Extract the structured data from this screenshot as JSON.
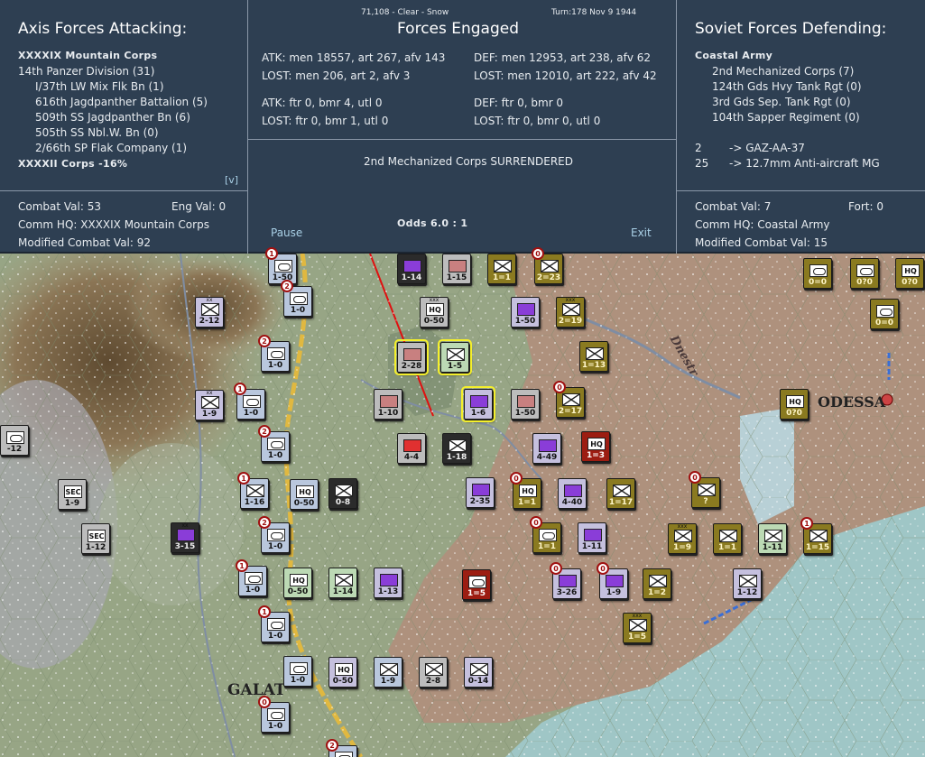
{
  "header": {
    "weather": "71,108 - Clear - Snow",
    "turn": "Turn:178  Nov 9 1944"
  },
  "axis": {
    "title": "Axis Forces Attacking:",
    "corps1": "XXXXIX Mountain Corps",
    "division": "14th Panzer Division (31)",
    "units": [
      "I/37th LW Mix Flk Bn (1)",
      "616th Jagdpanther Battalion (5)",
      "509th SS Jagdpanther Bn (6)",
      "505th SS Nbl.W. Bn (0)",
      "2/66th SP Flak Company (1)"
    ],
    "corps2": "XXXXII Corps  -16%",
    "toggle": "[v]",
    "combat_val": "Combat Val: 53",
    "eng_val": "Eng Val: 0",
    "comm_hq": "Comm HQ: XXXXIX Mountain Corps",
    "modified": "Modified Combat Val: 92"
  },
  "engaged": {
    "title": "Forces Engaged",
    "atk_men": "ATK: men 18557, art 267, afv 143",
    "atk_lost": "LOST: men 206, art 2, afv 3",
    "def_men": "DEF: men 12953, art 238, afv 62",
    "def_lost": "LOST: men 12010, art 222, afv 42",
    "atk_air": "ATK: ftr 0, bmr 4, utl 0",
    "atk_air_lost": "LOST: ftr 0, bmr 1, utl 0",
    "def_air": "DEF: ftr 0, bmr 0",
    "def_air_lost": "LOST: ftr 0, bmr 0, utl 0",
    "result": "2nd Mechanized Corps SURRENDERED",
    "odds": "Odds 6.0 : 1",
    "pause": "Pause",
    "exit": "Exit"
  },
  "soviet": {
    "title": "Soviet Forces Defending:",
    "army": "Coastal Army",
    "units": [
      "2nd Mechanized Corps (7)",
      "124th Gds Hvy Tank Rgt (0)",
      "3rd Gds Sep. Tank Rgt (0)",
      "104th Sapper Regiment (0)"
    ],
    "loss1_n": "2",
    "loss1": "-> GAZ-AA-37",
    "loss2_n": "25",
    "loss2": "-> 12.7mm Anti-aircraft MG",
    "combat_val": "Combat Val: 7",
    "fort": "Fort: 0",
    "comm_hq": "Comm HQ: Coastal Army",
    "modified": "Modified Combat Val: 15"
  },
  "map_labels": {
    "river_dnestr": "Dnestr",
    "city_odessa": "ODESSA",
    "city_galati": "GALAT"
  },
  "counters": [
    {
      "v": "1-50",
      "c": "g-blue",
      "s": "arm",
      "b": "1"
    },
    {
      "v": "1-0",
      "c": "g-blue",
      "s": "arm",
      "b": "2"
    },
    {
      "v": "2-12",
      "c": "g-lav",
      "s": "inf",
      "e": "xx"
    },
    {
      "v": "1-0",
      "c": "g-blue",
      "s": "arm",
      "b": "2"
    },
    {
      "v": "1-9",
      "c": "g-lav",
      "s": "inf",
      "e": "xx"
    },
    {
      "v": "1-0",
      "c": "g-blue",
      "s": "arm",
      "b": "1"
    },
    {
      "v": "1-0",
      "c": "g-blue",
      "s": "arm",
      "b": "2"
    },
    {
      "v": "-12",
      "c": "g-gray",
      "s": "arm"
    },
    {
      "v": "1-9",
      "c": "g-gray",
      "s": "hqsym",
      "t": "SEC"
    },
    {
      "v": "1-12",
      "c": "g-gray",
      "s": "hqsym",
      "t": "SEC"
    },
    {
      "v": "1-16",
      "c": "g-blue",
      "s": "inf",
      "b": "1"
    },
    {
      "v": "0-50",
      "c": "g-blue",
      "s": "hqsym",
      "t": "HQ"
    },
    {
      "v": "0-8",
      "c": "g-black",
      "s": "inf"
    },
    {
      "v": "3-15",
      "c": "g-black",
      "s": "purplesym",
      "e": "xx"
    },
    {
      "v": "1-0",
      "c": "g-blue",
      "s": "arm",
      "b": "2"
    },
    {
      "v": "1-0",
      "c": "g-blue",
      "s": "arm",
      "b": "1"
    },
    {
      "v": "0-50",
      "c": "g-green",
      "s": "hqsym",
      "t": "HQ"
    },
    {
      "v": "1-14",
      "c": "g-green",
      "s": "inf"
    },
    {
      "v": "1-13",
      "c": "g-lav",
      "s": "purplesym"
    },
    {
      "v": "1-0",
      "c": "g-blue",
      "s": "arm",
      "b": "1"
    },
    {
      "v": "1-0",
      "c": "g-blue",
      "s": "arm"
    },
    {
      "v": "0-50",
      "c": "g-lav",
      "s": "hqsym",
      "t": "HQ"
    },
    {
      "v": "1-9",
      "c": "g-blue",
      "s": "inf"
    },
    {
      "v": "2-8",
      "c": "g-gray",
      "s": "inf"
    },
    {
      "v": "0-14",
      "c": "g-lav",
      "s": "inf"
    },
    {
      "v": "1-0",
      "c": "g-blue",
      "s": "arm",
      "b": "0"
    },
    {
      "v": "1-14",
      "c": "g-black",
      "s": "purplesym"
    },
    {
      "v": "1-15",
      "c": "g-gray",
      "s": "armred2"
    },
    {
      "v": "0-50",
      "c": "g-gray",
      "s": "hqsym",
      "t": "HQ",
      "e": "xxx"
    },
    {
      "v": "2-28",
      "c": "g-gray",
      "s": "armred2",
      "sel": true
    },
    {
      "v": "1-5",
      "c": "g-green",
      "s": "inf",
      "sel": true
    },
    {
      "v": "1-10",
      "c": "g-gray",
      "s": "armred2"
    },
    {
      "v": "1-6",
      "c": "g-lav",
      "s": "purplesym",
      "sel": true
    },
    {
      "v": "1-50",
      "c": "g-gray",
      "s": "armred2"
    },
    {
      "v": "4-4",
      "c": "g-gray",
      "s": "armred"
    },
    {
      "v": "1-18",
      "c": "g-black",
      "s": "inf"
    },
    {
      "v": "4-49",
      "c": "g-lav",
      "s": "armpurple"
    },
    {
      "v": "2-35",
      "c": "g-lav",
      "s": "armpurple"
    },
    {
      "v": "1=1",
      "c": "g-olive",
      "s": "inf"
    },
    {
      "v": "2=23",
      "c": "g-olive",
      "s": "inf",
      "b": "0"
    },
    {
      "v": "1-50",
      "c": "g-lav",
      "s": "purplesym"
    },
    {
      "v": "2=19",
      "c": "g-olive",
      "s": "inf",
      "e": "xxx"
    },
    {
      "v": "1=13",
      "c": "g-olive",
      "s": "inf"
    },
    {
      "v": "2=17",
      "c": "g-olive",
      "s": "inf",
      "b": "0"
    },
    {
      "v": "1=3",
      "c": "g-red",
      "s": "hqsym",
      "t": "HQ"
    },
    {
      "v": "1=1",
      "c": "g-olive",
      "s": "hqsym",
      "t": "HQ",
      "b": "0"
    },
    {
      "v": "4-40",
      "c": "g-lav",
      "s": "purplesym"
    },
    {
      "v": "1=17",
      "c": "g-olive",
      "s": "inf"
    },
    {
      "v": "?",
      "c": "g-olive",
      "s": "inf",
      "b": "0"
    },
    {
      "v": "0=0",
      "c": "g-olive",
      "s": "arm"
    },
    {
      "v": "0?0",
      "c": "g-olive",
      "s": "arm"
    },
    {
      "v": "0?0",
      "c": "g-olive",
      "s": "hqsym",
      "t": "HQ"
    },
    {
      "v": "0=0",
      "c": "g-olive",
      "s": "arm"
    },
    {
      "v": "0?0",
      "c": "g-olive",
      "s": "hqsym",
      "t": "HQ"
    },
    {
      "v": "1=1",
      "c": "g-olive",
      "s": "arm",
      "b": "0"
    },
    {
      "v": "1-11",
      "c": "g-lav",
      "s": "purplesym"
    },
    {
      "v": "1=9",
      "c": "g-olive",
      "s": "inf",
      "e": "xxx"
    },
    {
      "v": "1=1",
      "c": "g-olive",
      "s": "inf"
    },
    {
      "v": "1-11",
      "c": "g-green",
      "s": "inf"
    },
    {
      "v": "1=15",
      "c": "g-olive",
      "s": "inf",
      "b": "1"
    },
    {
      "v": "1=5",
      "c": "g-red",
      "s": "arm"
    },
    {
      "v": "3-26",
      "c": "g-lav",
      "s": "purplesym",
      "b": "0"
    },
    {
      "v": "1-9",
      "c": "g-lav",
      "s": "purplesym",
      "b": "0"
    },
    {
      "v": "1=2",
      "c": "g-olive",
      "s": "inf"
    },
    {
      "v": "1-12",
      "c": "g-lav",
      "s": "inf"
    },
    {
      "v": "1=5",
      "c": "g-olive",
      "s": "inf",
      "e": "xxx"
    },
    {
      "v": "",
      "c": "g-blue",
      "s": "arm",
      "b": "2"
    }
  ]
}
